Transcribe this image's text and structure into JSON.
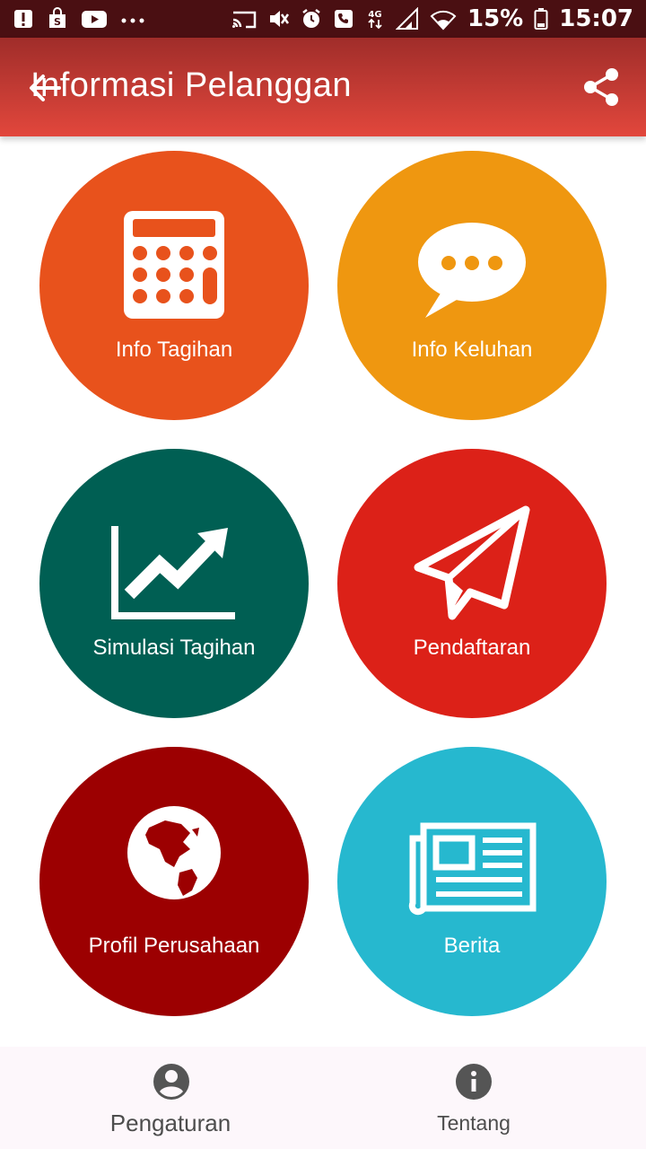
{
  "status_bar": {
    "battery_percent": "15%",
    "time": "15:07",
    "network": "4G",
    "icons": [
      "alert-icon",
      "shopping-icon",
      "youtube-icon",
      "more-dots-icon",
      "cast-icon",
      "mute-icon",
      "alarm-icon",
      "call-icon",
      "signal-icon",
      "wifi-icon",
      "battery-icon"
    ]
  },
  "app_bar": {
    "title": "Informasi Pelanggan",
    "back_icon": "arrow-back-icon",
    "share_icon": "share-icon"
  },
  "menu": {
    "tiles": [
      {
        "label": "Info Tagihan",
        "icon": "calculator-icon",
        "color": "#e8521c"
      },
      {
        "label": "Info Keluhan",
        "icon": "chat-bubble-icon",
        "color": "#ef9710"
      },
      {
        "label": "Simulasi Tagihan",
        "icon": "trend-chart-icon",
        "color": "#005f53"
      },
      {
        "label": "Pendaftaran",
        "icon": "paper-plane-icon",
        "color": "#dc2118"
      },
      {
        "label": "Profil Perusahaan",
        "icon": "globe-icon",
        "color": "#9c0001"
      },
      {
        "label": "Berita",
        "icon": "newspaper-icon",
        "color": "#26b8cf"
      }
    ]
  },
  "bottom_nav": {
    "items": [
      {
        "label": "Pengaturan",
        "icon": "account-circle-icon"
      },
      {
        "label": "Tentang",
        "icon": "info-icon"
      }
    ]
  },
  "colors": {
    "status_bar_bg": "#4a0f12",
    "app_bar_top": "#a02d2a",
    "app_bar_bottom": "#e2473c",
    "bottom_nav_bg": "#fdf7fb",
    "nav_icon": "#555555"
  }
}
